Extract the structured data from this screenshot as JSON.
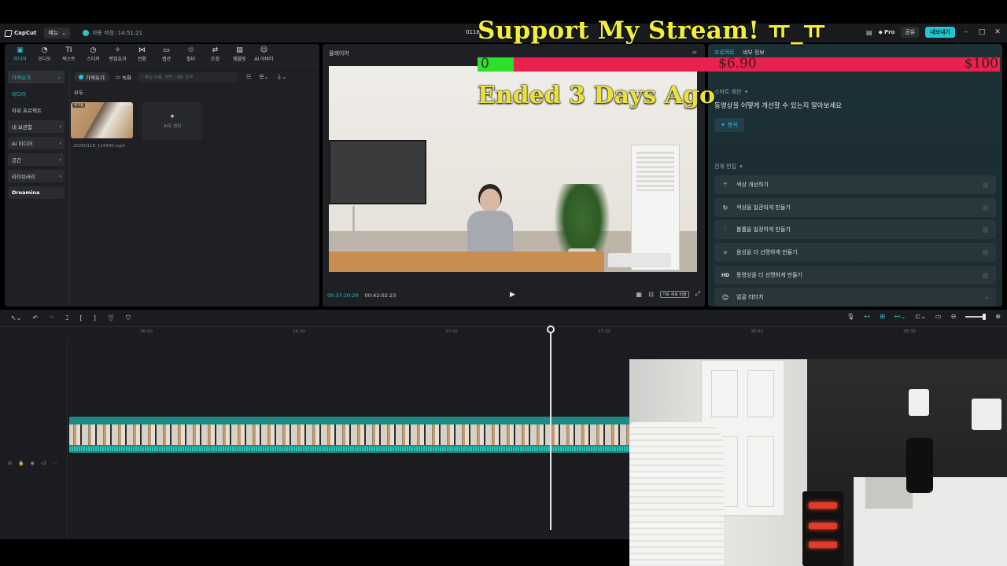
{
  "titlebar": {
    "app_name": "CapCut",
    "menu_label": "메뉴",
    "autosave_text": "자동 저장: 14:51:21",
    "project_name": "0118",
    "pro_label": "Pro",
    "share_label": "공유",
    "export_label": "내보내기"
  },
  "toolbar": {
    "items": [
      {
        "label": "미디어",
        "icon": "media-icon"
      },
      {
        "label": "오디오",
        "icon": "audio-icon"
      },
      {
        "label": "텍스트",
        "icon": "text-icon"
      },
      {
        "label": "스티커",
        "icon": "sticker-icon"
      },
      {
        "label": "편집효과",
        "icon": "effects-icon"
      },
      {
        "label": "전환",
        "icon": "transition-icon"
      },
      {
        "label": "캡션",
        "icon": "caption-icon"
      },
      {
        "label": "필터",
        "icon": "filter-icon"
      },
      {
        "label": "조정",
        "icon": "adjust-icon"
      },
      {
        "label": "템플릿",
        "icon": "template-icon"
      },
      {
        "label": "AI 아바타",
        "icon": "avatar-icon"
      }
    ]
  },
  "media_sidebar": {
    "items": [
      {
        "label": "가져오기"
      },
      {
        "label": "미디어"
      },
      {
        "label": "하위 프로젝트"
      },
      {
        "label": "내 보관함"
      },
      {
        "label": "AI 미디어"
      },
      {
        "label": "공간"
      },
      {
        "label": "라이브러리"
      },
      {
        "label": "Dreamina"
      }
    ]
  },
  "media_toolbar": {
    "import_label": "가져오기",
    "record_label": "녹화",
    "search_placeholder": "파일 이름, 장면, 대화 검색"
  },
  "media_content": {
    "section_label": "모두",
    "clip_badge": "추가됨",
    "clip_duration": "42:16",
    "clip_name": "20260118_114430.mp4",
    "ai_generate_label": "AI로 생성"
  },
  "player": {
    "title": "플레이어",
    "current_time": "00:37:20:20",
    "total_time": "00:42:02:23",
    "ratio_label": "가로 세로 비율"
  },
  "right_panel": {
    "tabs": [
      "프로젝트",
      "세부 정보"
    ],
    "smart_title": "스마트 제안",
    "smart_text": "동영상을 어떻게 개선할 수 있는지 알아보세요",
    "analyze_label": "분석",
    "full_edit_title": "전체 편집",
    "actions": [
      {
        "label": "색상 개선하기",
        "icon": "magic-wand-icon"
      },
      {
        "label": "색상을 일관되게 만들기",
        "icon": "color-consistency-icon"
      },
      {
        "label": "볼륨을 일정하게 만들기",
        "icon": "volume-sliders-icon"
      },
      {
        "label": "음성을 더 선명하게 만들기",
        "icon": "voice-sparkle-icon"
      },
      {
        "label": "동영상을 더 선명하게 만들기",
        "icon": "hd-icon"
      },
      {
        "label": "얼굴 리터치",
        "icon": "face-retouch-icon"
      }
    ]
  },
  "timeline": {
    "ticks": [
      "36:00",
      "36:30",
      "37:00",
      "37:30",
      "38:00",
      "38:30"
    ]
  },
  "stream_overlay": {
    "title": "Support My Stream! ㅠ_ㅠ",
    "goal_start": "0",
    "goal_current": "$6.90",
    "goal_target": "$100",
    "goal_progress": 0.069,
    "status": "Ended 3 Days Ago",
    "title_color": "#f2ee3a",
    "bar_color": "#e8214e",
    "fill_color": "#2bdf2b"
  },
  "colors": {
    "accent": "#23c8d6",
    "panel_bg": "#1f2023"
  }
}
